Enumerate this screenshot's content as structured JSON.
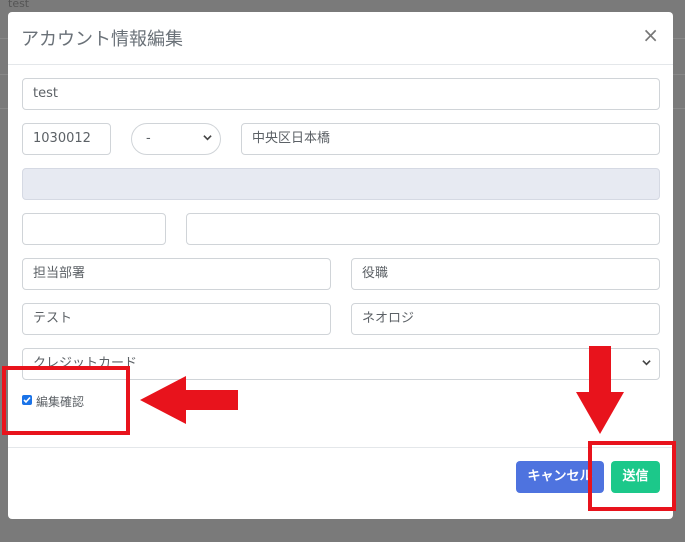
{
  "background": {
    "text": "test"
  },
  "modal": {
    "title": "アカウント情報編集",
    "close_glyph": "×",
    "fields": {
      "name": "test",
      "postal_code": "1030012",
      "prefecture_selected": "-",
      "address": "中央区日本橋",
      "address_2": "",
      "phone": "",
      "email": "",
      "department_placeholder": "担当部署",
      "position_placeholder": "役職",
      "last_name": "テスト",
      "first_name": "ネオロジ",
      "payment_selected": "クレジットカード"
    },
    "confirm_checkbox": {
      "label": "編集確認",
      "checked": true
    },
    "footer": {
      "cancel_label": "キャンセル",
      "submit_label": "送信"
    }
  },
  "colors": {
    "primary": "#4e73df",
    "success": "#1cc88a",
    "annotation": "#e8131c",
    "disabled_field": "#e7eaf2"
  }
}
